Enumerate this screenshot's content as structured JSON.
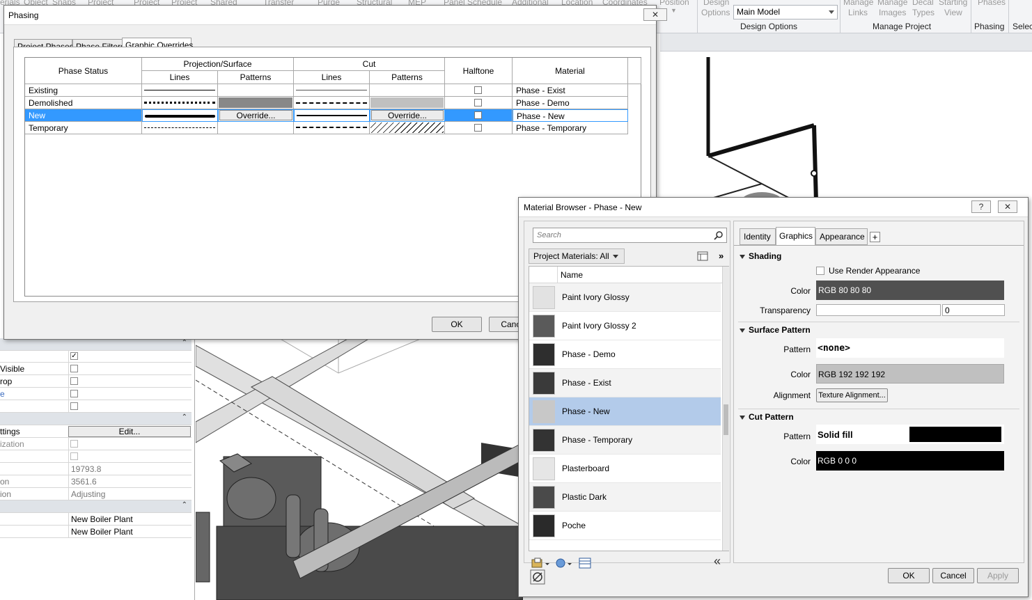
{
  "ribbon": {
    "partial_labels": [
      "erials",
      "Object",
      "Snaps",
      "Project",
      "Project",
      "Project",
      "Shared",
      "Transfer",
      "Purge",
      "Structural",
      "MEP",
      "Panel Schedule",
      "Additional",
      "Location",
      "Coordinates",
      "Position",
      "Design",
      "Manage",
      "Manage",
      "Decal",
      "Starting",
      "Phases"
    ],
    "sub_labels": [
      "Options",
      "Links",
      "Images",
      "Types",
      "View"
    ],
    "design_option_value": "Main Model",
    "groups": [
      "Design Options",
      "Manage Project",
      "Phasing",
      "Selec"
    ]
  },
  "properties": {
    "rows": [
      {
        "label": "",
        "type": "checkbox",
        "checked": true
      },
      {
        "label": "Visible",
        "type": "checkbox",
        "checked": false
      },
      {
        "label": "rop",
        "type": "checkbox",
        "checked": false
      },
      {
        "label": "e",
        "type": "checkbox",
        "checked": false
      },
      {
        "label": "",
        "type": "checkbox",
        "checked": false
      },
      {
        "label": "",
        "type": "section"
      },
      {
        "label": "ttings",
        "type": "button",
        "value": "Edit..."
      },
      {
        "label": "ization",
        "type": "checkbox",
        "checked": false
      },
      {
        "label": "",
        "type": "checkbox",
        "checked": false
      },
      {
        "label": "",
        "type": "text",
        "value": "19793.8"
      },
      {
        "label": "on",
        "type": "text",
        "value": "3561.6"
      },
      {
        "label": "ion",
        "type": "text",
        "value": "Adjusting"
      },
      {
        "label": "",
        "type": "section"
      },
      {
        "label": "",
        "type": "text",
        "value": "New Boiler Plant"
      },
      {
        "label": "",
        "type": "text",
        "value": "New Boiler Plant"
      }
    ]
  },
  "phasing": {
    "title": "Phasing",
    "close": "✕",
    "tabs": [
      "Project Phases",
      "Phase Filters",
      "Graphic Overrides"
    ],
    "active_tab": "Graphic Overrides",
    "headers": {
      "phase_status": "Phase Status",
      "projection": "Projection/Surface",
      "cut": "Cut",
      "lines": "Lines",
      "patterns": "Patterns",
      "halftone": "Halftone",
      "material": "Material"
    },
    "rows": [
      {
        "status": "Existing",
        "material": "Phase - Exist",
        "halftone": false
      },
      {
        "status": "Demolished",
        "material": "Phase - Demo",
        "halftone": false
      },
      {
        "status": "New",
        "material": "Phase - New",
        "halftone": false,
        "selected": true,
        "override": "Override..."
      },
      {
        "status": "Temporary",
        "material": "Phase - Temporary",
        "halftone": false
      }
    ],
    "ok": "OK",
    "cancel": "Cancel"
  },
  "material_browser": {
    "title": "Material Browser - Phase - New",
    "help": "?",
    "close": "✕",
    "search_placeholder": "Search",
    "filter": "Project Materials: All",
    "column": "Name",
    "materials": [
      {
        "name": "Paint Ivory Glossy",
        "swatch": "#e2e2e2"
      },
      {
        "name": "Paint Ivory Glossy 2",
        "swatch": "#5a5a5a"
      },
      {
        "name": "Phase - Demo",
        "swatch": "#2e2e2e"
      },
      {
        "name": "Phase - Exist",
        "swatch": "#3a3a3a"
      },
      {
        "name": "Phase - New",
        "swatch": "#c8c8c8",
        "selected": true
      },
      {
        "name": "Phase - Temporary",
        "swatch": "#333333"
      },
      {
        "name": "Plasterboard",
        "swatch": "#e6e6e6"
      },
      {
        "name": "Plastic Dark",
        "swatch": "#4a4a4a"
      },
      {
        "name": "Poche",
        "swatch": "#2a2a2a"
      }
    ],
    "tabs": [
      "Identity",
      "Graphics",
      "Appearance"
    ],
    "active_tab": "Graphics",
    "add_tab": "+",
    "shading": {
      "header": "Shading",
      "use_render": "Use Render Appearance",
      "color_label": "Color",
      "color_value": "RGB 80 80 80",
      "transparency_label": "Transparency",
      "transparency_value": "0"
    },
    "surface": {
      "header": "Surface Pattern",
      "pattern_label": "Pattern",
      "pattern_value": "<none>",
      "color_label": "Color",
      "color_value": "RGB 192 192 192",
      "alignment_label": "Alignment",
      "alignment_button": "Texture Alignment..."
    },
    "cut": {
      "header": "Cut Pattern",
      "pattern_label": "Pattern",
      "pattern_value": "Solid fill",
      "color_label": "Color",
      "color_value": "RGB 0 0 0"
    },
    "ok": "OK",
    "cancel": "Cancel",
    "apply": "Apply"
  }
}
